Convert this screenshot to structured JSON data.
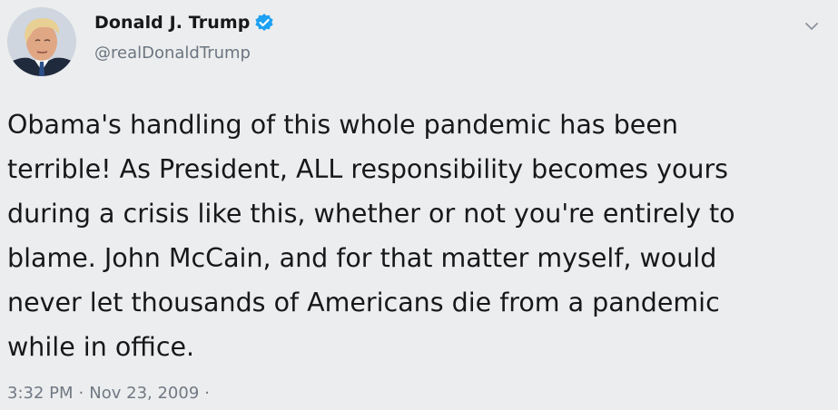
{
  "tweet": {
    "author": {
      "display_name": "Donald J. Trump",
      "handle": "@realDonaldTrump",
      "verified": true,
      "verified_icon": "verified-badge-icon",
      "avatar_icon": "profile-avatar"
    },
    "body": "Obama's handling of this whole pandemic has been\nterrible! As President, ALL responsibility becomes yours\nduring a crisis like this, whether or not you're entirely to\nblame. John McCain, and for that matter myself, would\nnever let thousands of Americans die from a pandemic\nwhile in office.",
    "time": "3:32 PM",
    "date": "Nov 23, 2009",
    "separator": "·",
    "trailing_separator": "·",
    "menu_icon": "chevron-down-icon"
  },
  "colors": {
    "background": "#ecedee",
    "text": "#17181a",
    "muted": "#6b7580",
    "verified_blue": "#1da1f2"
  }
}
